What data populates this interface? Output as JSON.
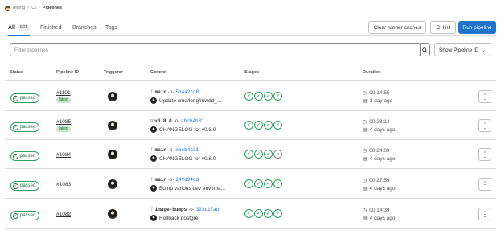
{
  "breadcrumb": {
    "items": [
      "releng",
      "CI",
      "Pipelines"
    ]
  },
  "tabs": [
    {
      "label": "All",
      "count": "521"
    },
    {
      "label": "Finished"
    },
    {
      "label": "Branches"
    },
    {
      "label": "Tags"
    }
  ],
  "actions": {
    "clear_caches": "Clear runner caches",
    "ci_lint": "CI lint",
    "run_pipeline": "Run pipeline"
  },
  "filter": {
    "placeholder": "Filter pipelines",
    "display": "Show Pipeline ID"
  },
  "columns": [
    "Status",
    "Pipeline ID",
    "Triggerer",
    "Commit",
    "Stages",
    "Duration"
  ],
  "rows": [
    {
      "status": "passed",
      "id": "#1101",
      "latest": "latest",
      "ref": "main",
      "sha": "5b4a2cc8",
      "message": "Update cmd/long/mwdd_...",
      "stages": [
        "passed",
        "passed",
        "passed",
        "passed"
      ],
      "duration": "00:14:55",
      "finished": "1 day ago"
    },
    {
      "status": "passed",
      "id": "#1085",
      "latest": "latest",
      "ref": "v0.8.0",
      "sha": "abcb4b31",
      "message": "CHANGELOG for v0.8.0",
      "stages": [
        "passed",
        "passed",
        "passed",
        "passed"
      ],
      "duration": "00:28:14",
      "finished": "4 days ago"
    },
    {
      "status": "passed",
      "id": "#1084",
      "ref": "main",
      "sha": "abcb4b31",
      "message": "CHANGELOG for v0.8.0",
      "stages": [
        "passed",
        "passed",
        "passed",
        "skipped"
      ],
      "duration": "00:24:09",
      "finished": "4 days ago"
    },
    {
      "status": "passed",
      "id": "#1083",
      "ref": "main",
      "sha": "24fd94cd",
      "message": "Bump various dev env ima...",
      "stages": [
        "passed",
        "passed",
        "passed",
        "passed"
      ],
      "duration": "00:27:59",
      "finished": "4 days ago"
    },
    {
      "status": "passed",
      "id": "#1082",
      "ref": "image-bumps",
      "sha": "323d1fad",
      "message": "Rollback postgre",
      "stages": [
        "passed",
        "passed",
        "passed",
        "passed"
      ],
      "duration": "00:14:39",
      "finished": "4 days ago"
    }
  ],
  "colors": {
    "accent": "#1f75cb",
    "success": "#217645"
  }
}
